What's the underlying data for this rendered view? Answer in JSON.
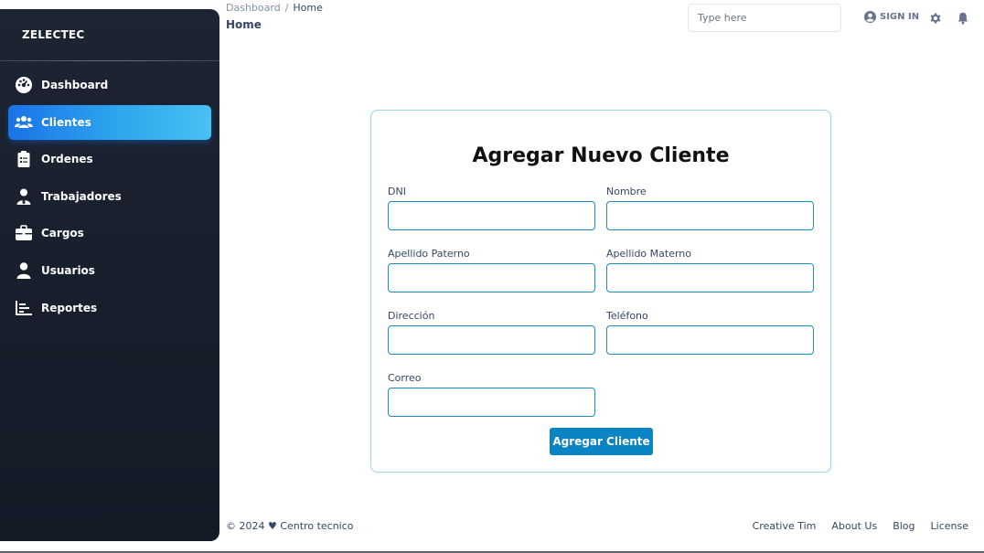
{
  "sidebar": {
    "brand": "ZELECTEC",
    "items": [
      {
        "label": "Dashboard",
        "icon": "dashboard-gauge-icon",
        "active": false
      },
      {
        "label": "Clientes",
        "icon": "users-group-icon",
        "active": true
      },
      {
        "label": "Ordenes",
        "icon": "clipboard-list-icon",
        "active": false
      },
      {
        "label": "Trabajadores",
        "icon": "user-tie-icon",
        "active": false
      },
      {
        "label": "Cargos",
        "icon": "briefcase-icon",
        "active": false
      },
      {
        "label": "Usuarios",
        "icon": "user-icon",
        "active": false
      },
      {
        "label": "Reportes",
        "icon": "bar-chart-icon",
        "active": false
      }
    ]
  },
  "header": {
    "breadcrumb": {
      "root": "Dashboard",
      "separator": "/",
      "current": "Home"
    },
    "title": "Home",
    "search": {
      "placeholder": "Type here",
      "value": ""
    },
    "signin_label": "SIGN IN"
  },
  "form": {
    "title": "Agregar Nuevo Cliente",
    "fields": {
      "dni": {
        "label": "DNI",
        "value": ""
      },
      "nombre": {
        "label": "Nombre",
        "value": ""
      },
      "apellido_paterno": {
        "label": "Apellido Paterno",
        "value": ""
      },
      "apellido_materno": {
        "label": "Apellido Materno",
        "value": ""
      },
      "direccion": {
        "label": "Dirección",
        "value": ""
      },
      "telefono": {
        "label": "Teléfono",
        "value": ""
      },
      "correo": {
        "label": "Correo",
        "value": ""
      }
    },
    "submit_label": "Agregar Cliente"
  },
  "footer": {
    "copyright": "© 2024 ♥ Centro tecnico",
    "links": [
      "Creative Tim",
      "About Us",
      "Blog",
      "License"
    ]
  },
  "colors": {
    "sidebar_bg": "#1d2433",
    "active_item": "#2fa6ee",
    "button": "#0b84c4",
    "input_border": "#1a8cc6",
    "card_border": "#9bd3ee"
  }
}
